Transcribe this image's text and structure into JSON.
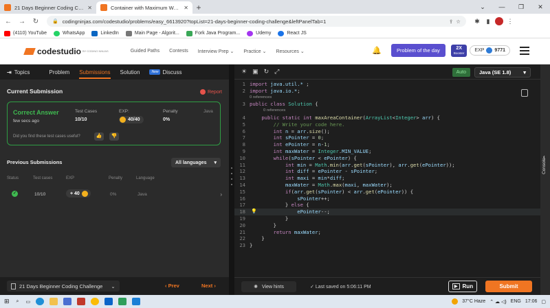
{
  "browser": {
    "tabs": [
      {
        "title": "21 Days Beginner Coding Challe",
        "close": "✕"
      },
      {
        "title": "Container with Maximum Water",
        "close": "✕"
      }
    ],
    "new_tab": "+",
    "url": "codingninjas.com/codestudio/problems/easy_6613920?topList=21-days-beginner-coding-challenge&leftPanelTab=1",
    "bookmarks": [
      {
        "label": "(4110) YouTube",
        "color": "#ff0000"
      },
      {
        "label": "WhatsApp",
        "color": "#25d366"
      },
      {
        "label": "LinkedIn",
        "color": "#0a66c2"
      },
      {
        "label": "Main Page - Algorit...",
        "color": "#777777"
      },
      {
        "label": "Fork Java Program...",
        "color": "#3aa757"
      },
      {
        "label": "Udemy",
        "color": "#a435f0"
      },
      {
        "label": "React JS",
        "color": "#1a73e8"
      }
    ]
  },
  "site": {
    "logo": "codestudio",
    "logo_sub": "BY CODING NINJAS",
    "nav": [
      "Guided Paths",
      "Contests",
      "Interview Prep ⌄",
      "Practice ⌄",
      "Resources ⌄"
    ],
    "potd": "Problem of the day",
    "booster": "2X",
    "booster_sub": "Booster",
    "exp_label": "EXP",
    "exp_value": "9771"
  },
  "left": {
    "tabs": {
      "topics": "Topics",
      "problem": "Problem",
      "submissions": "Submissions",
      "solution": "Solution",
      "new": "New",
      "discuss": "Discuss"
    },
    "current_title": "Current Submission",
    "report": "Report",
    "current": {
      "status": "Correct Answer",
      "time": "few secs ago",
      "test_cases_label": "Test Cases",
      "test_cases": "10/10",
      "exp_label": "EXP:",
      "exp": "40/40",
      "penalty_label": "Penalty",
      "penalty": "0%",
      "lang": "Java",
      "question": "Did you find these test cases useful?"
    },
    "previous_title": "Previous Submissions",
    "lang_filter": "All languages",
    "columns": {
      "status": "Status",
      "test_cases": "Test cases",
      "exp": "EXP",
      "penalty": "Penalty",
      "language": "Language"
    },
    "row": {
      "test_cases": "10/10",
      "exp": "+ 40",
      "penalty": "0%",
      "language": "Java"
    },
    "footer": {
      "course": "21 Days Beginner Coding Challenge",
      "prev": "‹ Prev",
      "next": "Next ›"
    }
  },
  "editor": {
    "auto": "Auto",
    "language": "Java (SE 1.8)",
    "refs": "0 references",
    "lines": [
      "1",
      "2",
      "",
      "3",
      "",
      "4",
      "5",
      "6",
      "7",
      "8",
      "9",
      "10",
      "11",
      "12",
      "13",
      "14",
      "15",
      "16",
      "17",
      "18",
      "19",
      "20",
      "21",
      "22",
      "23"
    ],
    "view_hints": "View hints",
    "saved": "Last saved on 5:06:11 PM",
    "run": "Run",
    "submit": "Submit",
    "console": "Console"
  },
  "taskbar": {
    "weather": "37°C  Haze",
    "lang": "ENG",
    "time": "17:06"
  }
}
